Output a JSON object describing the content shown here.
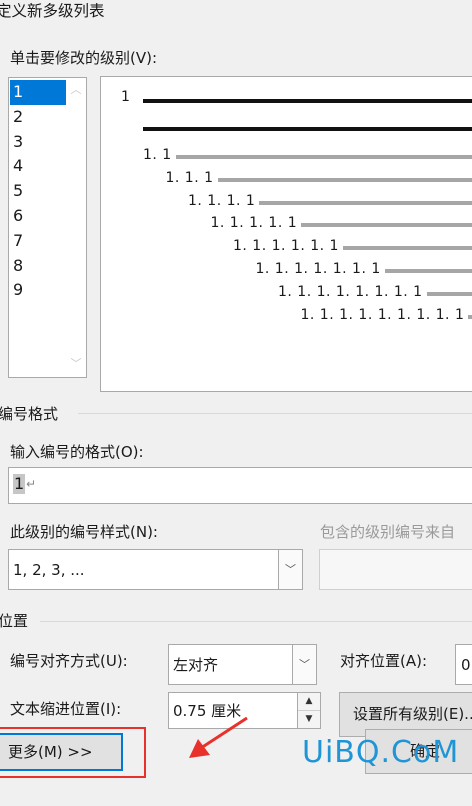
{
  "dialog": {
    "title": "定义新多级列表"
  },
  "level_section": {
    "label": "单击要修改的级别(V):",
    "levels": [
      "1",
      "2",
      "3",
      "4",
      "5",
      "6",
      "7",
      "8",
      "9"
    ],
    "selected": "1"
  },
  "preview": {
    "labels": [
      "1",
      "1. 1",
      "1. 1. 1",
      "1. 1. 1. 1",
      "1. 1. 1. 1. 1",
      "1. 1. 1. 1. 1. 1",
      "1. 1. 1. 1. 1. 1. 1",
      "1. 1. 1. 1. 1. 1. 1. 1",
      "1. 1. 1. 1. 1. 1. 1. 1. 1"
    ]
  },
  "number_format": {
    "group_label": "编号格式",
    "format_label": "输入编号的格式(O):",
    "format_value": "1",
    "format_mark": "↵",
    "style_label": "此级别的编号样式(N):",
    "style_value": "1, 2, 3, ...",
    "include_label": "包含的级别编号来自"
  },
  "position": {
    "group_label": "位置",
    "align_label": "编号对齐方式(U):",
    "align_value": "左对齐",
    "align_at_label": "对齐位置(A):",
    "align_at_value": "0",
    "indent_label": "文本缩进位置(I):",
    "indent_value": "0.75 厘米",
    "set_all_label": "设置所有级别(E)..."
  },
  "buttons": {
    "more": "更多(M) >>",
    "ok": "确定"
  },
  "watermark": {
    "text": "UiBQ.CoM"
  },
  "colors": {
    "selection": "#0078d7",
    "annotation": "#e8312a"
  }
}
